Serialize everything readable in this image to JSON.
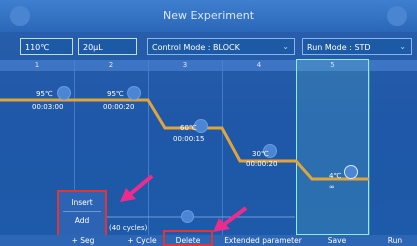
{
  "title": "New Experiment",
  "controls": {
    "cover": "110℃ Cover",
    "volume": "20μL Volume",
    "control_mode": "Control Mode : BLOCK",
    "run_mode": "Run Mode : STD"
  },
  "steps": [
    "1",
    "2",
    "3",
    "4",
    "5"
  ],
  "points": [
    {
      "temp": "95℃",
      "time": "00:03:00"
    },
    {
      "temp": "95℃",
      "time": "00:00:20"
    },
    {
      "temp": "60℃",
      "time": "00:00:15"
    },
    {
      "temp": "30℃",
      "time": "00:00:20"
    },
    {
      "temp": "4℃",
      "time": "∞"
    }
  ],
  "cycles": "(40 cycles)",
  "popup": {
    "insert": "Insert",
    "add": "Add"
  },
  "bottom": {
    "seg": "+ Seg",
    "cycle": "+ Cycle",
    "delete": "Delete",
    "extended": "Extended parameter",
    "save": "Save",
    "run": "Run"
  },
  "colors": {
    "profile_line": "#e0a53a",
    "highlight": "#e23434",
    "selected_step": "#8cf0e0",
    "arrow": "#ee2b8c"
  }
}
